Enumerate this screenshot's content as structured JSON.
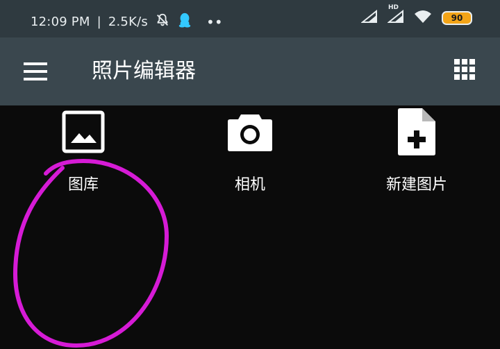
{
  "status_bar": {
    "time": "12:09 PM",
    "network_speed": "2.5K/s",
    "battery_level": "90",
    "hd_label": "HD",
    "icons": [
      "bell-muted-icon",
      "qq-icon",
      "more-dots-icon",
      "signal-icon",
      "signal-hd-icon",
      "wifi-icon",
      "battery-icon"
    ]
  },
  "app_bar": {
    "title": "照片编辑器",
    "menu_icon": "hamburger-menu-icon",
    "apps_icon": "grid-apps-icon"
  },
  "tiles": [
    {
      "label": "图库",
      "icon": "image-icon"
    },
    {
      "label": "相机",
      "icon": "camera-icon"
    },
    {
      "label": "新建图片",
      "icon": "new-file-icon"
    }
  ],
  "colors": {
    "status_bar": "#2f3a40",
    "app_bar": "#3a474e",
    "background": "#0b0b0b",
    "highlight": "#d61bd6",
    "battery": "#f3a417"
  }
}
